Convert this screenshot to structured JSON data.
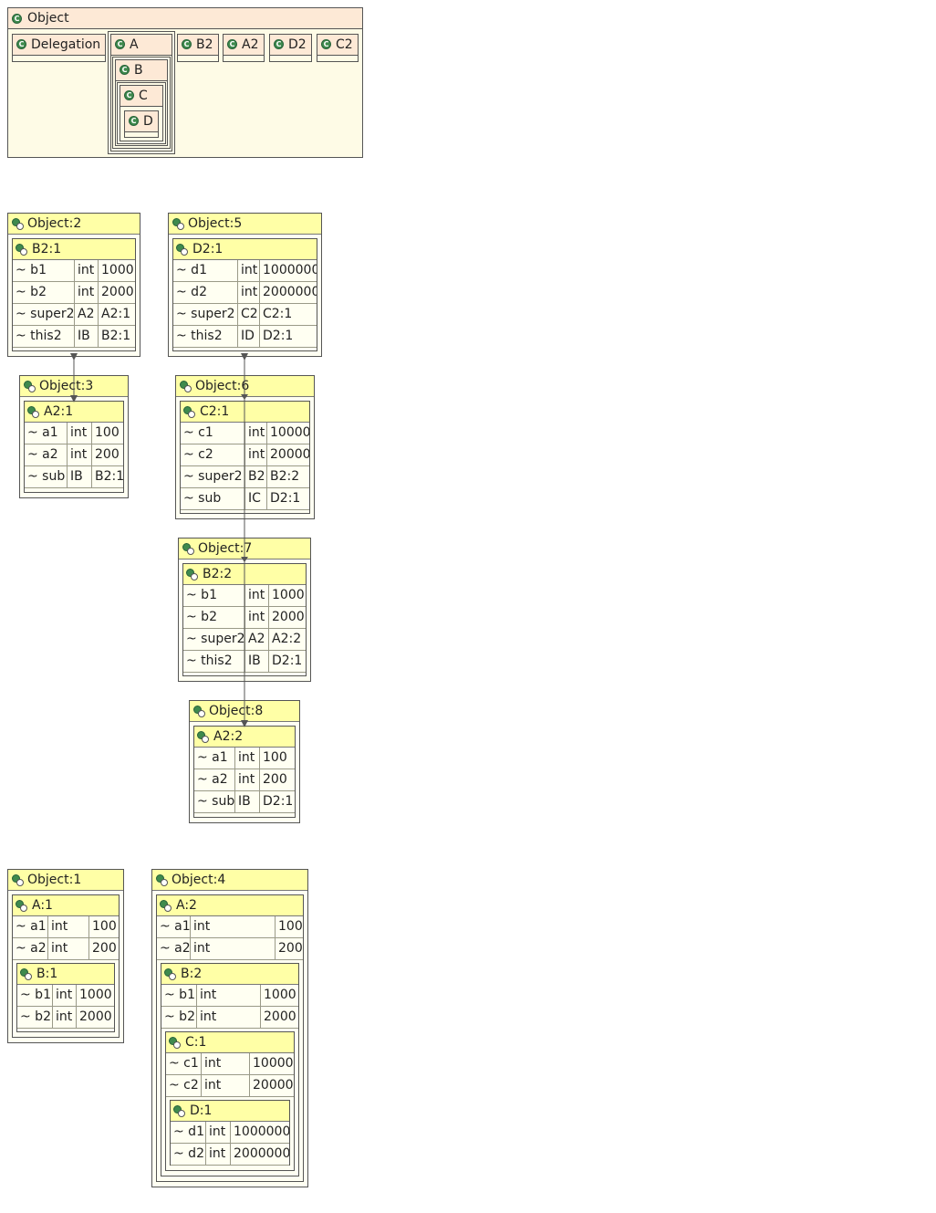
{
  "classes": {
    "root": "Object",
    "children": [
      "Delegation",
      "A",
      "B2",
      "A2",
      "D2",
      "C2"
    ],
    "nested": [
      "B",
      "C",
      "D"
    ]
  },
  "objects": {
    "o2": {
      "title": "Object:2",
      "inst": "B2:1",
      "rows": [
        [
          "~ b1",
          "int",
          "1000"
        ],
        [
          "~ b2",
          "int",
          "2000"
        ],
        [
          "~ super2",
          "A2",
          "A2:1"
        ],
        [
          "~ this2",
          "IB",
          "B2:1"
        ]
      ]
    },
    "o3": {
      "title": "Object:3",
      "inst": "A2:1",
      "rows": [
        [
          "~ a1",
          "int",
          "100"
        ],
        [
          "~ a2",
          "int",
          "200"
        ],
        [
          "~ sub",
          "IB",
          "B2:1"
        ]
      ]
    },
    "o5": {
      "title": "Object:5",
      "inst": "D2:1",
      "rows": [
        [
          "~ d1",
          "int",
          "1000000"
        ],
        [
          "~ d2",
          "int",
          "2000000"
        ],
        [
          "~ super2",
          "C2",
          "C2:1"
        ],
        [
          "~ this2",
          "ID",
          "D2:1"
        ]
      ]
    },
    "o6": {
      "title": "Object:6",
      "inst": "C2:1",
      "rows": [
        [
          "~ c1",
          "int",
          "10000"
        ],
        [
          "~ c2",
          "int",
          "20000"
        ],
        [
          "~ super2",
          "B2",
          "B2:2"
        ],
        [
          "~ sub",
          "IC",
          "D2:1"
        ]
      ]
    },
    "o7": {
      "title": "Object:7",
      "inst": "B2:2",
      "rows": [
        [
          "~ b1",
          "int",
          "1000"
        ],
        [
          "~ b2",
          "int",
          "2000"
        ],
        [
          "~ super2",
          "A2",
          "A2:2"
        ],
        [
          "~ this2",
          "IB",
          "D2:1"
        ]
      ]
    },
    "o8": {
      "title": "Object:8",
      "inst": "A2:2",
      "rows": [
        [
          "~ a1",
          "int",
          "100"
        ],
        [
          "~ a2",
          "int",
          "200"
        ],
        [
          "~ sub",
          "IB",
          "D2:1"
        ]
      ]
    },
    "o1": {
      "title": "Object:1",
      "inst": "A:1",
      "rows": [
        [
          "~ a1",
          "int",
          "100"
        ],
        [
          "~ a2",
          "int",
          "200"
        ]
      ],
      "nested": {
        "inst": "B:1",
        "rows": [
          [
            "~ b1",
            "int",
            "1000"
          ],
          [
            "~ b2",
            "int",
            "2000"
          ]
        ]
      }
    },
    "o4": {
      "title": "Object:4",
      "inst": "A:2",
      "rows": [
        [
          "~ a1",
          "int",
          "100"
        ],
        [
          "~ a2",
          "int",
          "200"
        ]
      ],
      "b": {
        "inst": "B:2",
        "rows": [
          [
            "~ b1",
            "int",
            "1000"
          ],
          [
            "~ b2",
            "int",
            "2000"
          ]
        ]
      },
      "c": {
        "inst": "C:1",
        "rows": [
          [
            "~ c1",
            "int",
            "10000"
          ],
          [
            "~ c2",
            "int",
            "20000"
          ]
        ]
      },
      "d": {
        "inst": "D:1",
        "rows": [
          [
            "~ d1",
            "int",
            "1000000"
          ],
          [
            "~ d2",
            "int",
            "2000000"
          ]
        ]
      }
    }
  },
  "colors": {
    "class_header": "#fde9d6",
    "class_body": "#fefbe6",
    "object_header": "#ffffa6",
    "object_body": "#fffff2",
    "icon_green": "#3f8a4d",
    "connector": "#555555"
  }
}
